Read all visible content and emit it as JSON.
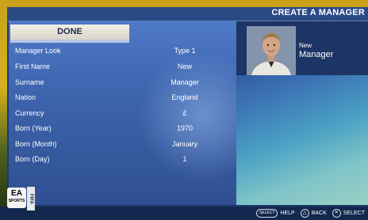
{
  "header": {
    "title": "CREATE A MANAGER"
  },
  "done_button": {
    "label": "DONE"
  },
  "rows": [
    {
      "label": "Manager Look",
      "value": "Type 1"
    },
    {
      "label": "First Name",
      "value": "New"
    },
    {
      "label": "Surname",
      "value": "Manager"
    },
    {
      "label": "Nation",
      "value": "England"
    },
    {
      "label": "Currency",
      "value": "£"
    },
    {
      "label": "Born (Year)",
      "value": "1970"
    },
    {
      "label": "Born (Month)",
      "value": "January"
    },
    {
      "label": "Born (Day)",
      "value": "1"
    }
  ],
  "manager_card": {
    "first_name": "New",
    "surname": "Manager"
  },
  "footer": {
    "ea_logo": {
      "main": "EA",
      "sub": "SPORTS"
    },
    "fifa_logo": "FIFA",
    "hints": [
      {
        "button": "SELECT",
        "label": "HELP"
      },
      {
        "button": "△",
        "label": "BACK"
      },
      {
        "button": "✕",
        "label": "SELECT"
      }
    ]
  }
}
